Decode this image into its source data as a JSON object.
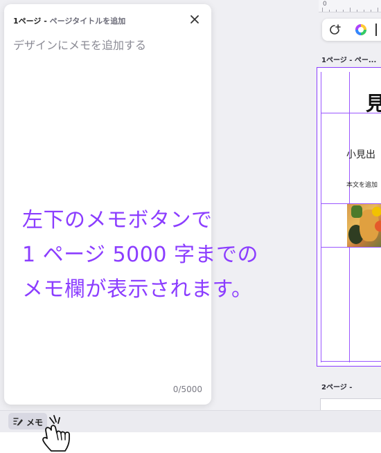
{
  "memo_panel": {
    "page_number": "1ページ",
    "separator": " - ",
    "title_placeholder": "ページタイトルを追加",
    "memo_placeholder": "デザインにメモを追加する",
    "char_count": "0/5000"
  },
  "canvas": {
    "ruler_zero": "0",
    "page1_label": "1ページ - ペー...",
    "page1_heading": "見",
    "page1_subheading": "小見出",
    "page1_body": "本文を追加",
    "page2_label": "2ページ - "
  },
  "annotation": {
    "line1": "左下のメモボタンで",
    "line2": "1 ページ 5000 字までの",
    "line3": "メモ欄が表示されます。"
  },
  "bottom_bar": {
    "memo_button_label": "メモ"
  },
  "colors": {
    "accent_purple": "#8b3dff",
    "editor_bg": "#efeff3"
  },
  "icons": {
    "close": "close-icon",
    "memo": "pencil-lines-icon",
    "pointer": "hand-pointer-icon",
    "add": "add-sparkle-icon",
    "color": "color-wheel-icon"
  }
}
